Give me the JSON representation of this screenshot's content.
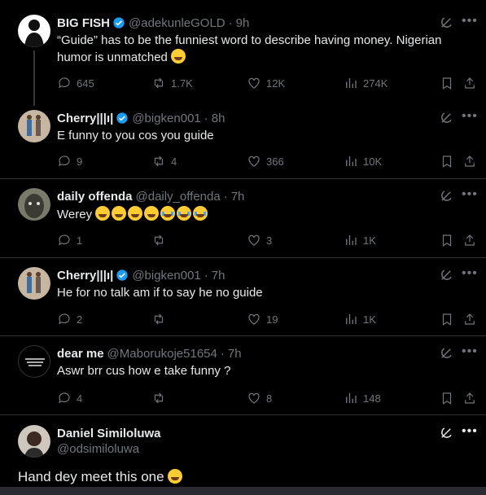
{
  "tweets": [
    {
      "name": "BIG FISH",
      "verified": true,
      "handle": "@adekunleGOLD",
      "time": "9h",
      "text": "“Guide” has to be the funniest word to describe having money. Nigerian humor is unmatched",
      "emoji_count": 1,
      "emoji_style": "laugh",
      "replies": "645",
      "reposts": "1.7K",
      "likes": "12K",
      "views": "274K"
    },
    {
      "name": "Cherry|||ı|",
      "verified": true,
      "handle": "@bigken001",
      "time": "8h",
      "text": "E funny to you cos you guide",
      "replies": "9",
      "reposts": "4",
      "likes": "366",
      "views": "10K"
    },
    {
      "name": "daily offenda",
      "verified": false,
      "handle": "@daily_offenda",
      "time": "7h",
      "text": "Werey",
      "emoji_count": 7,
      "replies": "1",
      "reposts": "",
      "likes": "3",
      "views": "1K"
    },
    {
      "name": "Cherry|||ı|",
      "verified": true,
      "handle": "@bigken001",
      "time": "7h",
      "text": "He for no talk am if to say he no guide",
      "replies": "2",
      "reposts": "",
      "likes": "19",
      "views": "1K"
    },
    {
      "name": "dear me",
      "verified": false,
      "handle": "@Maborukoje51654",
      "time": "7h",
      "text": "Aswr brr cus how e take funny ?",
      "replies": "4",
      "reposts": "",
      "likes": "8",
      "views": "148"
    }
  ],
  "composer": {
    "name": "Daniel Similoluwa",
    "handle": "@odsimiloluwa",
    "text": "Hand dey meet this one"
  },
  "colors": {
    "background": "#000000",
    "text": "#e7e9ea",
    "muted": "#71767b",
    "verified": "#1d9bf0",
    "separator": "#2f3336"
  }
}
